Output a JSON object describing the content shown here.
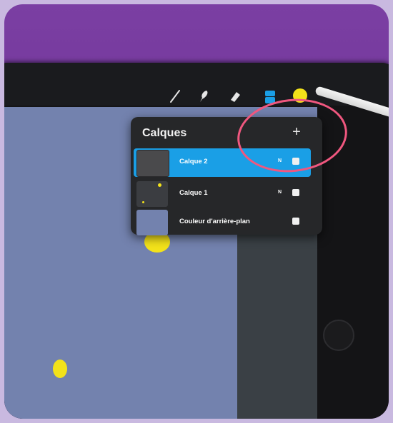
{
  "layers_panel": {
    "title": "Calques",
    "add_symbol": "+",
    "layers": [
      {
        "name": "Calque 2",
        "mode": "N",
        "visible": true,
        "active": true
      },
      {
        "name": "Calque 1",
        "mode": "N",
        "visible": true,
        "active": false
      },
      {
        "name": "Couleur d'arrière-plan",
        "mode": "",
        "visible": true,
        "active": false
      }
    ]
  },
  "toolbar": {
    "icons": [
      "brush-icon",
      "smudge-icon",
      "eraser-icon",
      "layers-icon",
      "color-swatch"
    ]
  },
  "colors": {
    "accent": "#1a9fe6",
    "canvas": "#7382ae",
    "swatch": "#f3e21a",
    "annotation": "#f0577f"
  }
}
